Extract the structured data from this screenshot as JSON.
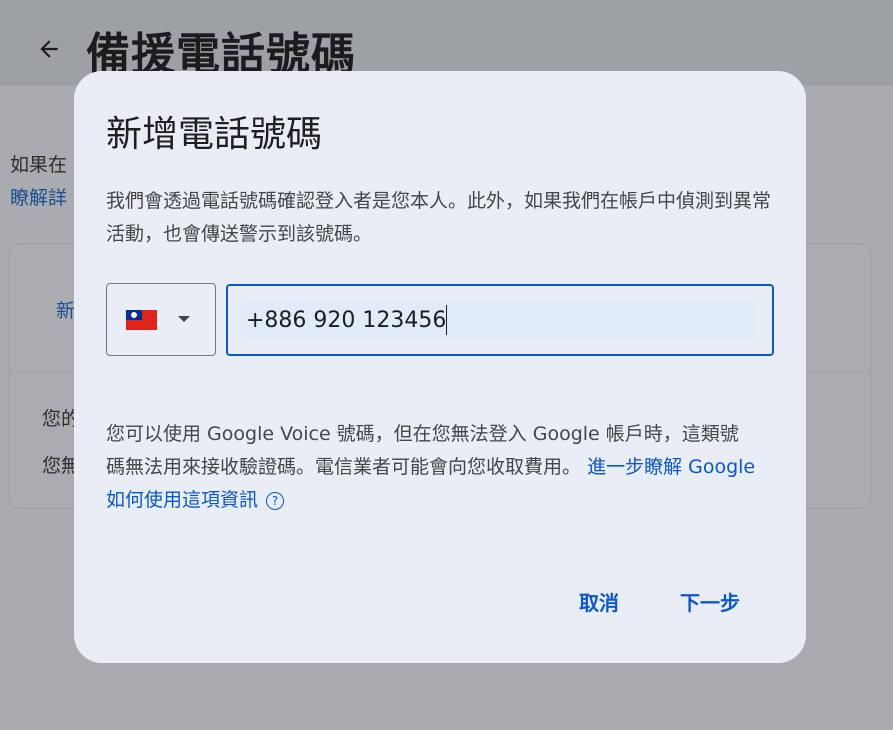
{
  "background": {
    "page_title": "備援電話號碼",
    "line1": "如果在",
    "link": "瞭解詳",
    "card_text1": "新",
    "card_text2": "您的",
    "card_text3": "您無"
  },
  "dialog": {
    "title": "新增電話號碼",
    "description": "我們會透過電話號碼確認登入者是您本人。此外，如果我們在帳戶中偵測到異常活動，也會傳送警示到該號碼。",
    "phone_value": "+886 920 123456",
    "note_text": "您可以使用 Google Voice 號碼，但在您無法登入 Google 帳戶時，這類號碼無法用來接收驗證碼。電信業者可能會向您收取費用。",
    "learn_more": "進一步瞭解 Google 如何使用這項資訊",
    "help_glyph": "?",
    "cancel_label": "取消",
    "next_label": "下一步"
  },
  "icons": {
    "back": "arrow-left-icon",
    "flag": "taiwan-flag-icon",
    "caret": "caret-down-icon",
    "help": "help-circle-icon"
  },
  "colors": {
    "accent": "#0b57d0",
    "dialog_bg": "#e9eef6",
    "scrim_bg": "#a9abae"
  }
}
